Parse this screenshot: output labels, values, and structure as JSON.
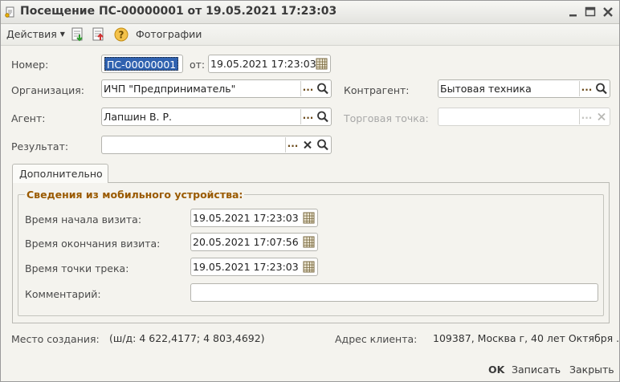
{
  "window": {
    "title": "Посещение ПС-00000001 от 19.05.2021 17:23:03"
  },
  "toolbar": {
    "actions_label": "Действия",
    "photos_label": "Фотографии"
  },
  "header": {
    "number_label": "Номер:",
    "number_value": "ПС-00000001",
    "date_label": "от:",
    "date_value": "19.05.2021 17:23:03"
  },
  "form": {
    "organization_label": "Организация:",
    "organization_value": "ИЧП \"Предприниматель\"",
    "contractor_label": "Контрагент:",
    "contractor_value": "Бытовая техника",
    "agent_label": "Агент:",
    "agent_value": "Лапшин В. Р.",
    "outlet_label": "Торговая точка:",
    "outlet_value": "",
    "result_label": "Результат:",
    "result_value": ""
  },
  "tabs": [
    {
      "label": "Дополнительно"
    }
  ],
  "mobile": {
    "group_title": "Сведения из мобильного устройства:",
    "visit_start_label": "Время начала визита:",
    "visit_start_value": "19.05.2021 17:23:03",
    "visit_end_label": "Время окончания визита:",
    "visit_end_value": "20.05.2021 17:07:56",
    "track_point_label": "Время точки трека:",
    "track_point_value": "19.05.2021 17:23:03",
    "comment_label": "Комментарий:",
    "comment_value": ""
  },
  "info": {
    "creation_place_label": "Место создания:",
    "creation_place_value": "(ш/д: 4 622,4177; 4 803,4692)",
    "client_address_label": "Адрес клиента:",
    "client_address_value": "109387, Москва г, 40 лет Октября ..."
  },
  "footer": {
    "ok_label": "OK",
    "save_label": "Записать",
    "close_label": "Закрыть"
  },
  "colors": {
    "group_title": "#9a5a00",
    "selection": "#3062b0",
    "window_bg": "#f4f3ee"
  }
}
